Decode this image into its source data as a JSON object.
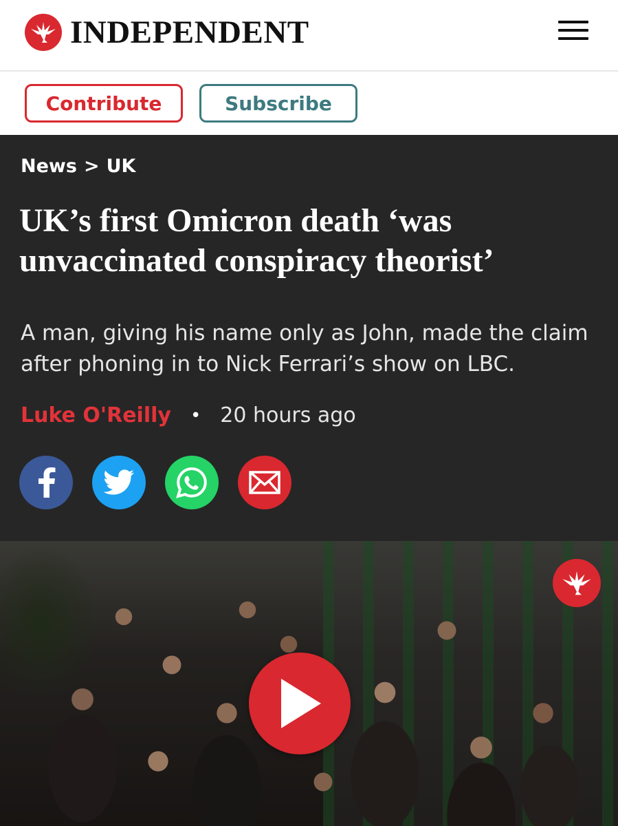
{
  "header": {
    "brand": "INDEPENDENT",
    "logo_icon": "eagle-icon",
    "menu_icon": "hamburger-menu-icon"
  },
  "actions": {
    "contribute_label": "Contribute",
    "subscribe_label": "Subscribe"
  },
  "breadcrumb": {
    "section": "News",
    "separator": ">",
    "subsection": "UK"
  },
  "article": {
    "headline": "UK’s first Omicron death ‘was unvaccinated conspiracy theorist’",
    "standfirst": "A man, giving his name only as John, made the claim after phoning in to Nick Ferrari’s show on LBC.",
    "author": "Luke O'Reilly",
    "byline_separator": "•",
    "published": "20 hours ago"
  },
  "share": [
    {
      "name": "facebook",
      "icon": "facebook-icon",
      "color": "#3b5998"
    },
    {
      "name": "twitter",
      "icon": "twitter-icon",
      "color": "#1da1f2"
    },
    {
      "name": "whatsapp",
      "icon": "whatsapp-icon",
      "color": "#25d366"
    },
    {
      "name": "email",
      "icon": "email-icon",
      "color": "#d9282f"
    }
  ],
  "media": {
    "play_icon": "play-icon",
    "badge_icon": "eagle-icon"
  },
  "colors": {
    "brand_red": "#d9282f",
    "subscribe_teal": "#3d7a80",
    "hero_background": "#262626"
  }
}
